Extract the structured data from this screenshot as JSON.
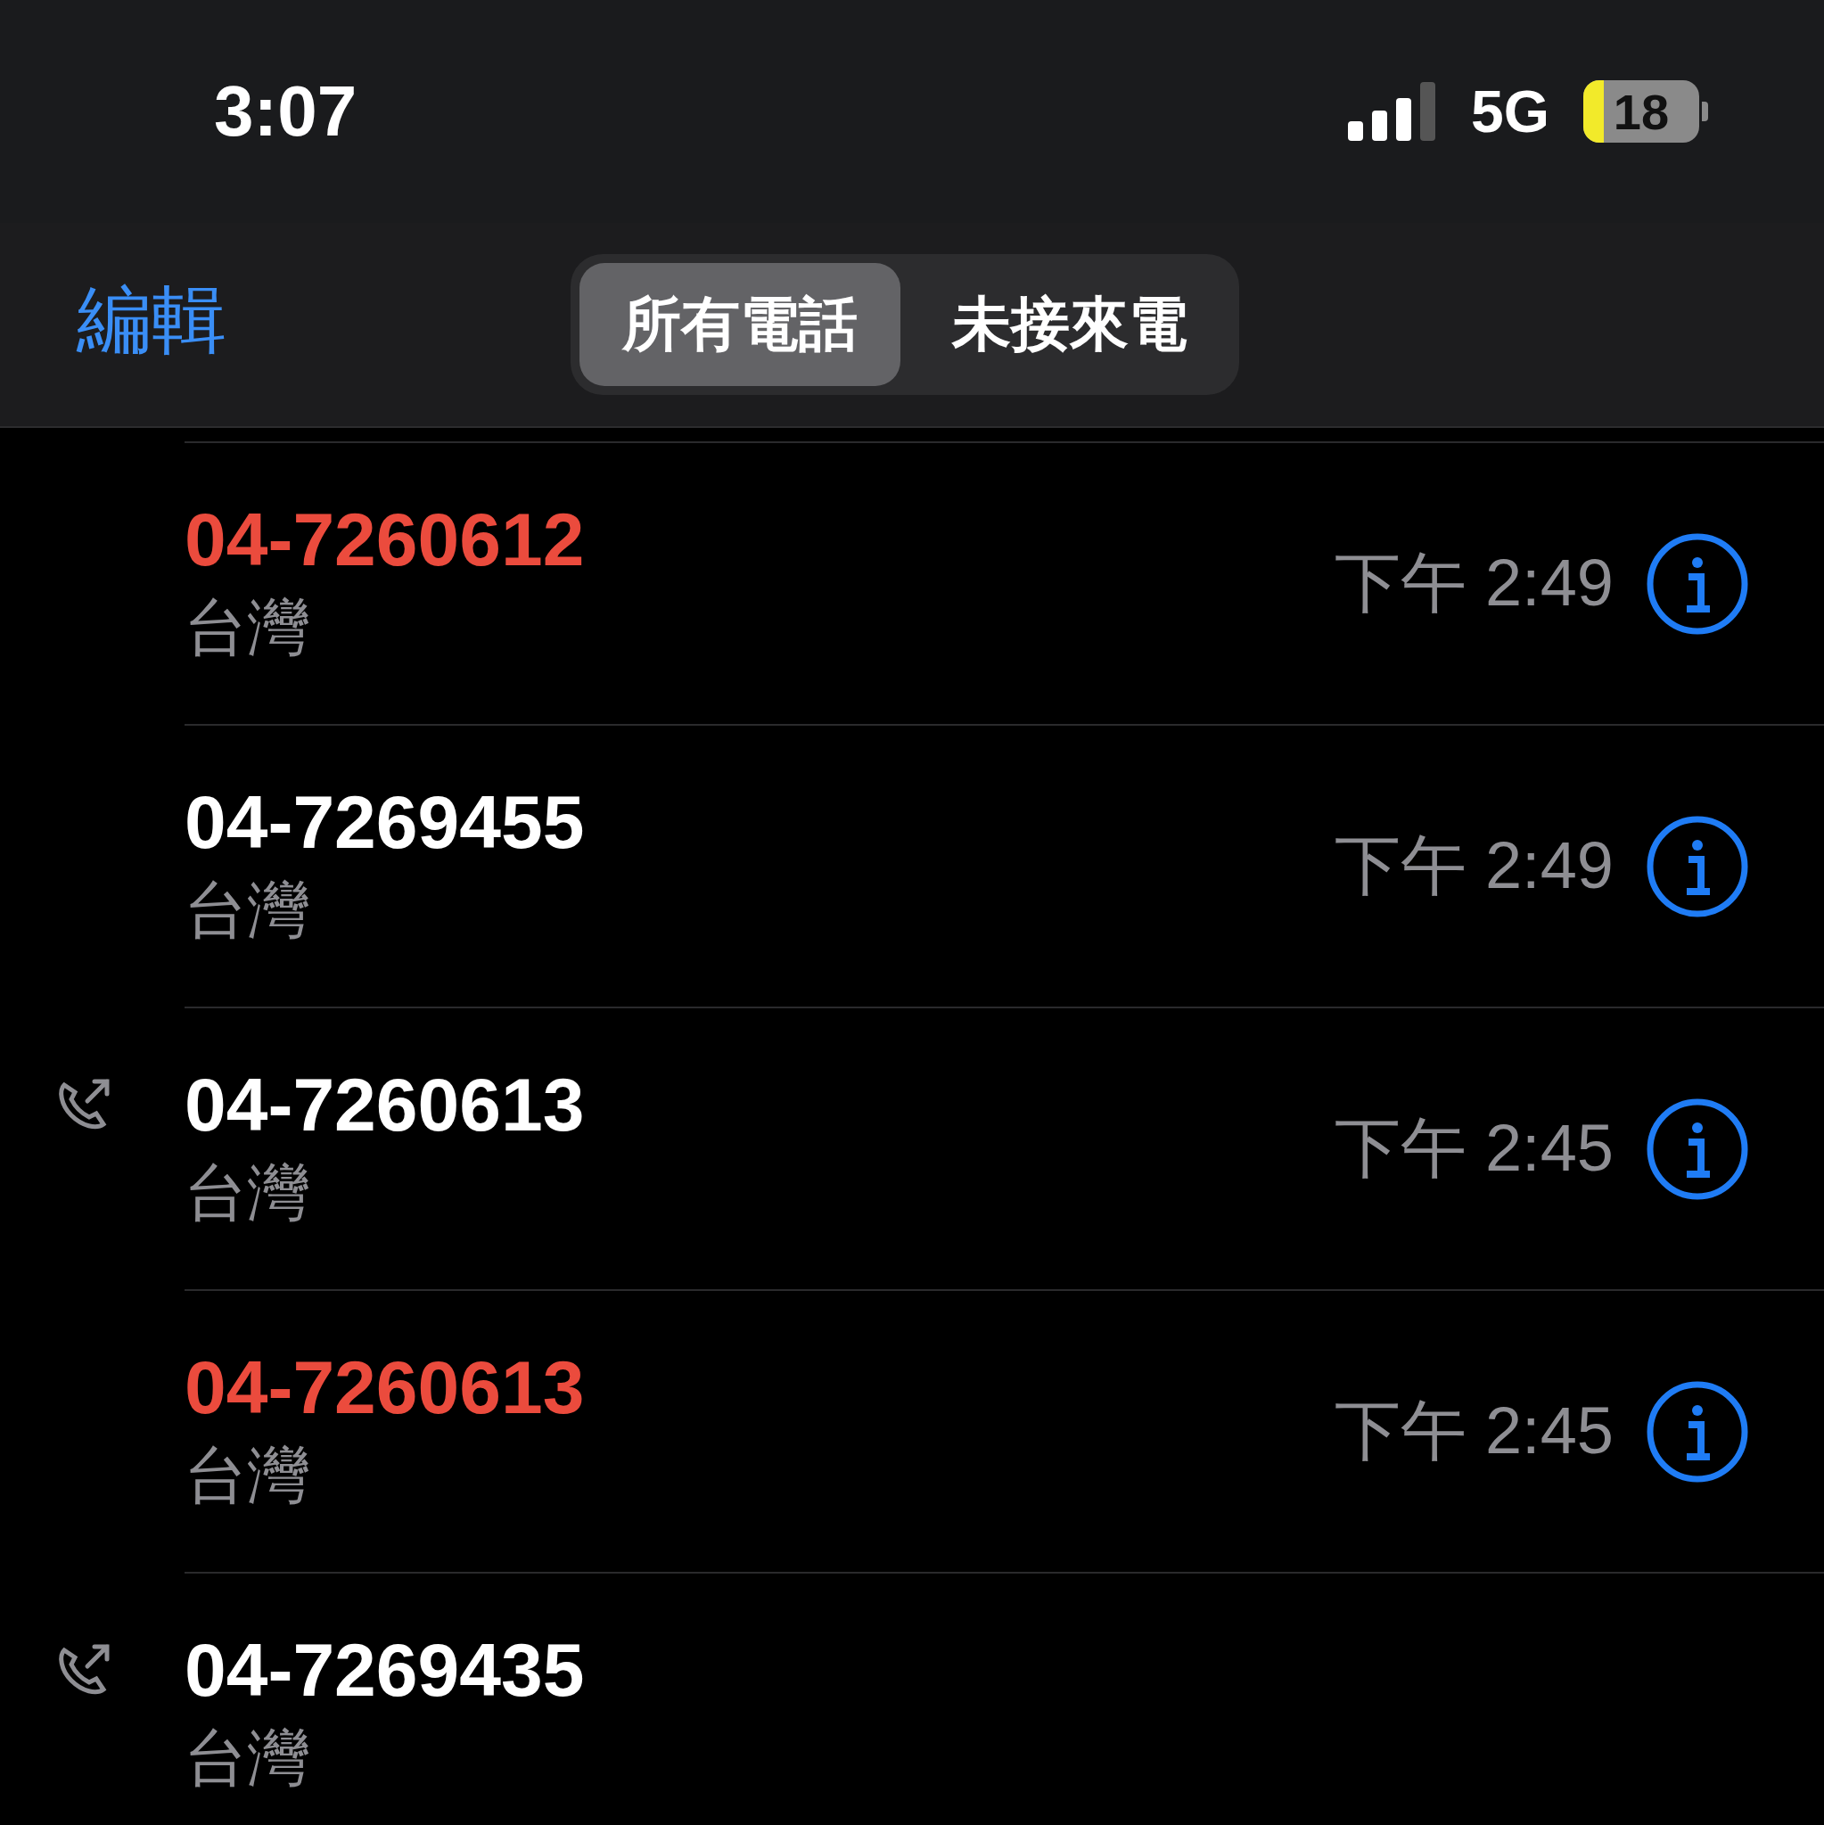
{
  "status_bar": {
    "time": "3:07",
    "network": "5G",
    "battery": "18"
  },
  "nav": {
    "edit": "編輯",
    "segments": [
      {
        "label": "所有電話",
        "selected": true
      },
      {
        "label": "未接來電",
        "selected": false
      }
    ]
  },
  "calls": [
    {
      "number": "04-7260612",
      "missed": true,
      "outgoing": false,
      "location": "台灣",
      "time": "下午 2:49"
    },
    {
      "number": "04-7269455",
      "missed": false,
      "outgoing": false,
      "location": "台灣",
      "time": "下午 2:49"
    },
    {
      "number": "04-7260613",
      "missed": false,
      "outgoing": true,
      "location": "台灣",
      "time": "下午 2:45"
    },
    {
      "number": "04-7260613",
      "missed": true,
      "outgoing": false,
      "location": "台灣",
      "time": "下午 2:45"
    },
    {
      "number": "04-7269435",
      "missed": false,
      "outgoing": true,
      "location": "台灣"
    }
  ]
}
